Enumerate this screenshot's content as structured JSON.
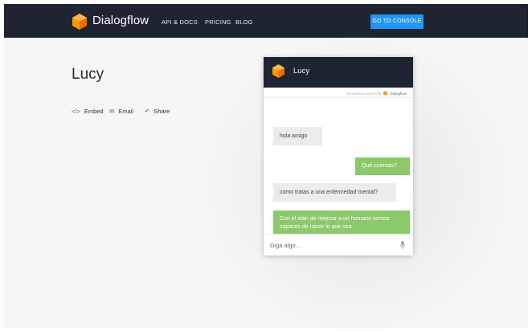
{
  "header": {
    "brand": "Dialogflow",
    "nav": [
      "API & DOCS",
      "PRICING",
      "BLOG"
    ],
    "console_button": "GO TO CONSOLE"
  },
  "agent": {
    "name": "Lucy",
    "actions": {
      "embed": "Embed",
      "email": "Email",
      "share": "Share"
    }
  },
  "widget": {
    "title": "Lucy",
    "powered_by": "DESARROLLADO POR",
    "powered_brand": "Dialogflow",
    "messages": [
      {
        "from": "user",
        "text": "hola amigo"
      },
      {
        "from": "bot",
        "text": "Qué cuentas?"
      },
      {
        "from": "user",
        "text": "como tratas a una enfermedad mental?"
      },
      {
        "from": "bot",
        "text": "Con el afán de mejorar a un humano somos capaces de hacer lo que sea"
      }
    ],
    "input_placeholder": "Diga algo..."
  },
  "colors": {
    "header_bg": "#1e2432",
    "accent_blue": "#2196f3",
    "bot_bubble": "#8bc96a",
    "user_bubble": "#ececec",
    "logo_orange": "#ff9800"
  },
  "icons": {
    "embed": "code-icon",
    "email": "mail-icon",
    "share": "reply-share-icon",
    "mic": "microphone-icon",
    "logo": "dialogflow-hexagon-logo"
  }
}
